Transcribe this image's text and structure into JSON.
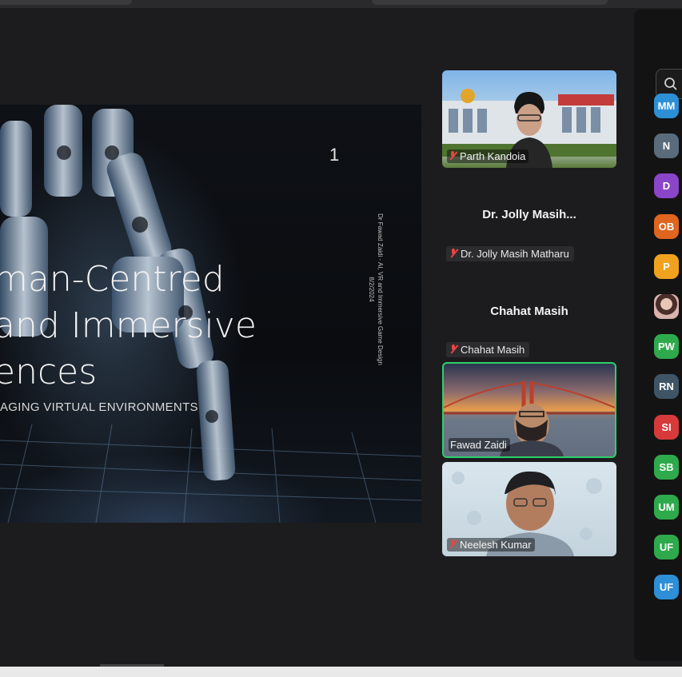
{
  "slide": {
    "page_number": "1",
    "vertical_text_line1": "Dr Fawad Zaidi - AI, VR and Immersive Game Design",
    "vertical_text_line2": "8/2/2024",
    "title_line1": "man-Centred",
    "title_line2": "and Immersive",
    "title_line3": "ences",
    "subtitle": "AGING VIRTUAL ENVIRONMENTS"
  },
  "participants": [
    {
      "id": "parth",
      "name": "Parth Kandoia",
      "video": true,
      "muted": true
    },
    {
      "id": "jolly",
      "display_name": "Dr. Jolly Masih...",
      "tag": "Dr. Jolly Masih Matharu",
      "video": false,
      "muted": true
    },
    {
      "id": "chahat",
      "display_name": "Chahat Masih",
      "tag": "Chahat Masih",
      "video": false,
      "muted": true
    },
    {
      "id": "fawad",
      "name": "Fawad Zaidi",
      "video": true,
      "muted": false,
      "active_speaker": true
    },
    {
      "id": "neelesh",
      "name": "Neelesh Kumar",
      "video": true,
      "muted": true
    }
  ],
  "panel": {
    "search_icon": "search-icon",
    "avatars": [
      {
        "initials": "MM",
        "color": "#2d8fd6"
      },
      {
        "initials": "N",
        "color": "#5a6b7c"
      },
      {
        "initials": "D",
        "color": "#8a45c9"
      },
      {
        "initials": "OB",
        "color": "#e0651f"
      },
      {
        "initials": "P",
        "color": "#f0a21e"
      },
      {
        "initials": "",
        "color": "#c9a9a6",
        "photo": true
      },
      {
        "initials": "PW",
        "color": "#2eaa4c"
      },
      {
        "initials": "RN",
        "color": "#3f5566"
      },
      {
        "initials": "SI",
        "color": "#d63a3a"
      },
      {
        "initials": "SB",
        "color": "#2eaa4c"
      },
      {
        "initials": "UM",
        "color": "#2eaa4c"
      },
      {
        "initials": "UF",
        "color": "#2eaa4c"
      },
      {
        "initials": "UF",
        "color": "#2d8fd6"
      }
    ]
  }
}
